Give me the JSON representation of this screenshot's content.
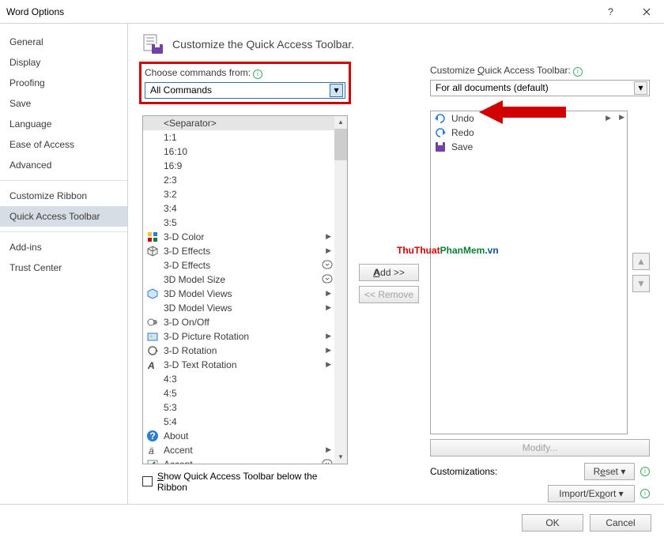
{
  "window": {
    "title": "Word Options"
  },
  "sidebar": {
    "items": [
      {
        "label": "General"
      },
      {
        "label": "Display"
      },
      {
        "label": "Proofing"
      },
      {
        "label": "Save"
      },
      {
        "label": "Language"
      },
      {
        "label": "Ease of Access"
      },
      {
        "label": "Advanced"
      },
      {
        "label": "Customize Ribbon"
      },
      {
        "label": "Quick Access Toolbar",
        "selected": true
      },
      {
        "label": "Add-ins"
      },
      {
        "label": "Trust Center"
      }
    ]
  },
  "header": {
    "title": "Customize the Quick Access Toolbar."
  },
  "left": {
    "label": "Choose commands from:",
    "select_value": "All Commands",
    "items": [
      {
        "label": "<Separator>",
        "sep": true
      },
      {
        "label": "1:1"
      },
      {
        "label": "16:10"
      },
      {
        "label": "16:9"
      },
      {
        "label": "2:3"
      },
      {
        "label": "3:2"
      },
      {
        "label": "3:4"
      },
      {
        "label": "3:5"
      },
      {
        "label": "3-D Color",
        "icon": "color",
        "sub": true
      },
      {
        "label": "3-D Effects",
        "icon": "cube",
        "sub": true
      },
      {
        "label": "3-D Effects",
        "sub": true,
        "drop": true
      },
      {
        "label": "3D Model Size",
        "drop": true
      },
      {
        "label": "3D Model Views",
        "icon": "cube2",
        "sub": true
      },
      {
        "label": "3D Model Views",
        "sub": true
      },
      {
        "label": "3-D On/Off",
        "icon": "toggle"
      },
      {
        "label": "3-D Picture Rotation",
        "icon": "picrot",
        "sub": true
      },
      {
        "label": "3-D Rotation",
        "icon": "rot",
        "sub": true
      },
      {
        "label": "3-D Text Rotation",
        "icon": "textrot",
        "sub": true
      },
      {
        "label": "4:3"
      },
      {
        "label": "4:5"
      },
      {
        "label": "5:3"
      },
      {
        "label": "5:4"
      },
      {
        "label": "About",
        "icon": "help"
      },
      {
        "label": "Accent",
        "icon": "accent",
        "sub": true
      },
      {
        "label": "Accept",
        "icon": "accept",
        "sub": true,
        "drop": true
      }
    ]
  },
  "mid": {
    "add": "Add >>",
    "remove": "<< Remove"
  },
  "right": {
    "label": "Customize Quick Access Toolbar:",
    "select_value": "For all documents (default)",
    "items": [
      {
        "label": "Undo",
        "icon": "undo",
        "sub": true
      },
      {
        "label": "Redo",
        "icon": "redo"
      },
      {
        "label": "Save",
        "icon": "save"
      }
    ],
    "modify": "Modify...",
    "customizations_label": "Customizations:",
    "reset": "Reset ▾",
    "import_export": "Import/Export ▾"
  },
  "checkbox": {
    "label": "Show Quick Access Toolbar below the Ribbon"
  },
  "footer": {
    "ok": "OK",
    "cancel": "Cancel"
  },
  "watermark": {
    "p1": "ThuThuat",
    "p2": "PhanMem",
    "p3": ".vn"
  }
}
